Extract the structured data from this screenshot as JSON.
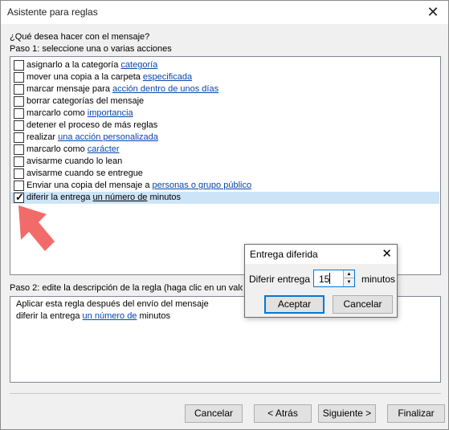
{
  "window": {
    "title": "Asistente para reglas"
  },
  "prompt": {
    "question": "¿Qué desea hacer con el mensaje?",
    "step1": "Paso 1: seleccione una o varias acciones"
  },
  "actions": [
    {
      "pre": "asignarlo a la categoría ",
      "link": "categoría",
      "post": "",
      "checked": false
    },
    {
      "pre": "mover una copia a la carpeta ",
      "link": "especificada",
      "post": "",
      "checked": false
    },
    {
      "pre": "marcar mensaje para ",
      "link": "acción dentro de unos días",
      "post": "",
      "checked": false
    },
    {
      "pre": "borrar categorías del mensaje",
      "link": "",
      "post": "",
      "checked": false
    },
    {
      "pre": "marcarlo como ",
      "link": "importancia",
      "post": "",
      "checked": false
    },
    {
      "pre": "detener el proceso de más reglas",
      "link": "",
      "post": "",
      "checked": false
    },
    {
      "pre": "realizar ",
      "link": "una acción personalizada",
      "post": "",
      "checked": false
    },
    {
      "pre": "marcarlo como ",
      "link": "carácter",
      "post": "",
      "checked": false
    },
    {
      "pre": "avisarme cuando lo lean",
      "link": "",
      "post": "",
      "checked": false
    },
    {
      "pre": "avisarme cuando se entregue",
      "link": "",
      "post": "",
      "checked": false
    },
    {
      "pre": "Enviar una copia del mensaje a ",
      "link": "personas o grupo público",
      "post": "",
      "checked": false
    },
    {
      "pre": "diferir la entrega ",
      "link": "un número de",
      "post": " minutos",
      "checked": true
    }
  ],
  "step2": {
    "label": "Paso 2: edite la descripción de la regla (haga clic en un valor",
    "line1": "Aplicar esta regla después del envío del mensaje",
    "line2_pre": "diferir la entrega ",
    "line2_link": "un número de",
    "line2_post": " minutos"
  },
  "buttons": {
    "cancel": "Cancelar",
    "back": "< Atrás",
    "next": "Siguiente >",
    "finish": "Finalizar"
  },
  "dialog": {
    "title": "Entrega diferida",
    "label": "Diferir entrega",
    "value": "15",
    "unit": "minutos",
    "accept": "Aceptar",
    "cancel": "Cancelar"
  },
  "colors": {
    "selection": "#cce4f7",
    "link": "#0645ad",
    "focus": "#0078d7",
    "arrow": "#f26b6b"
  },
  "icons": [
    "close-icon",
    "checkbox-icon",
    "spin-up-icon",
    "spin-down-icon",
    "pointer-arrow-icon"
  ]
}
